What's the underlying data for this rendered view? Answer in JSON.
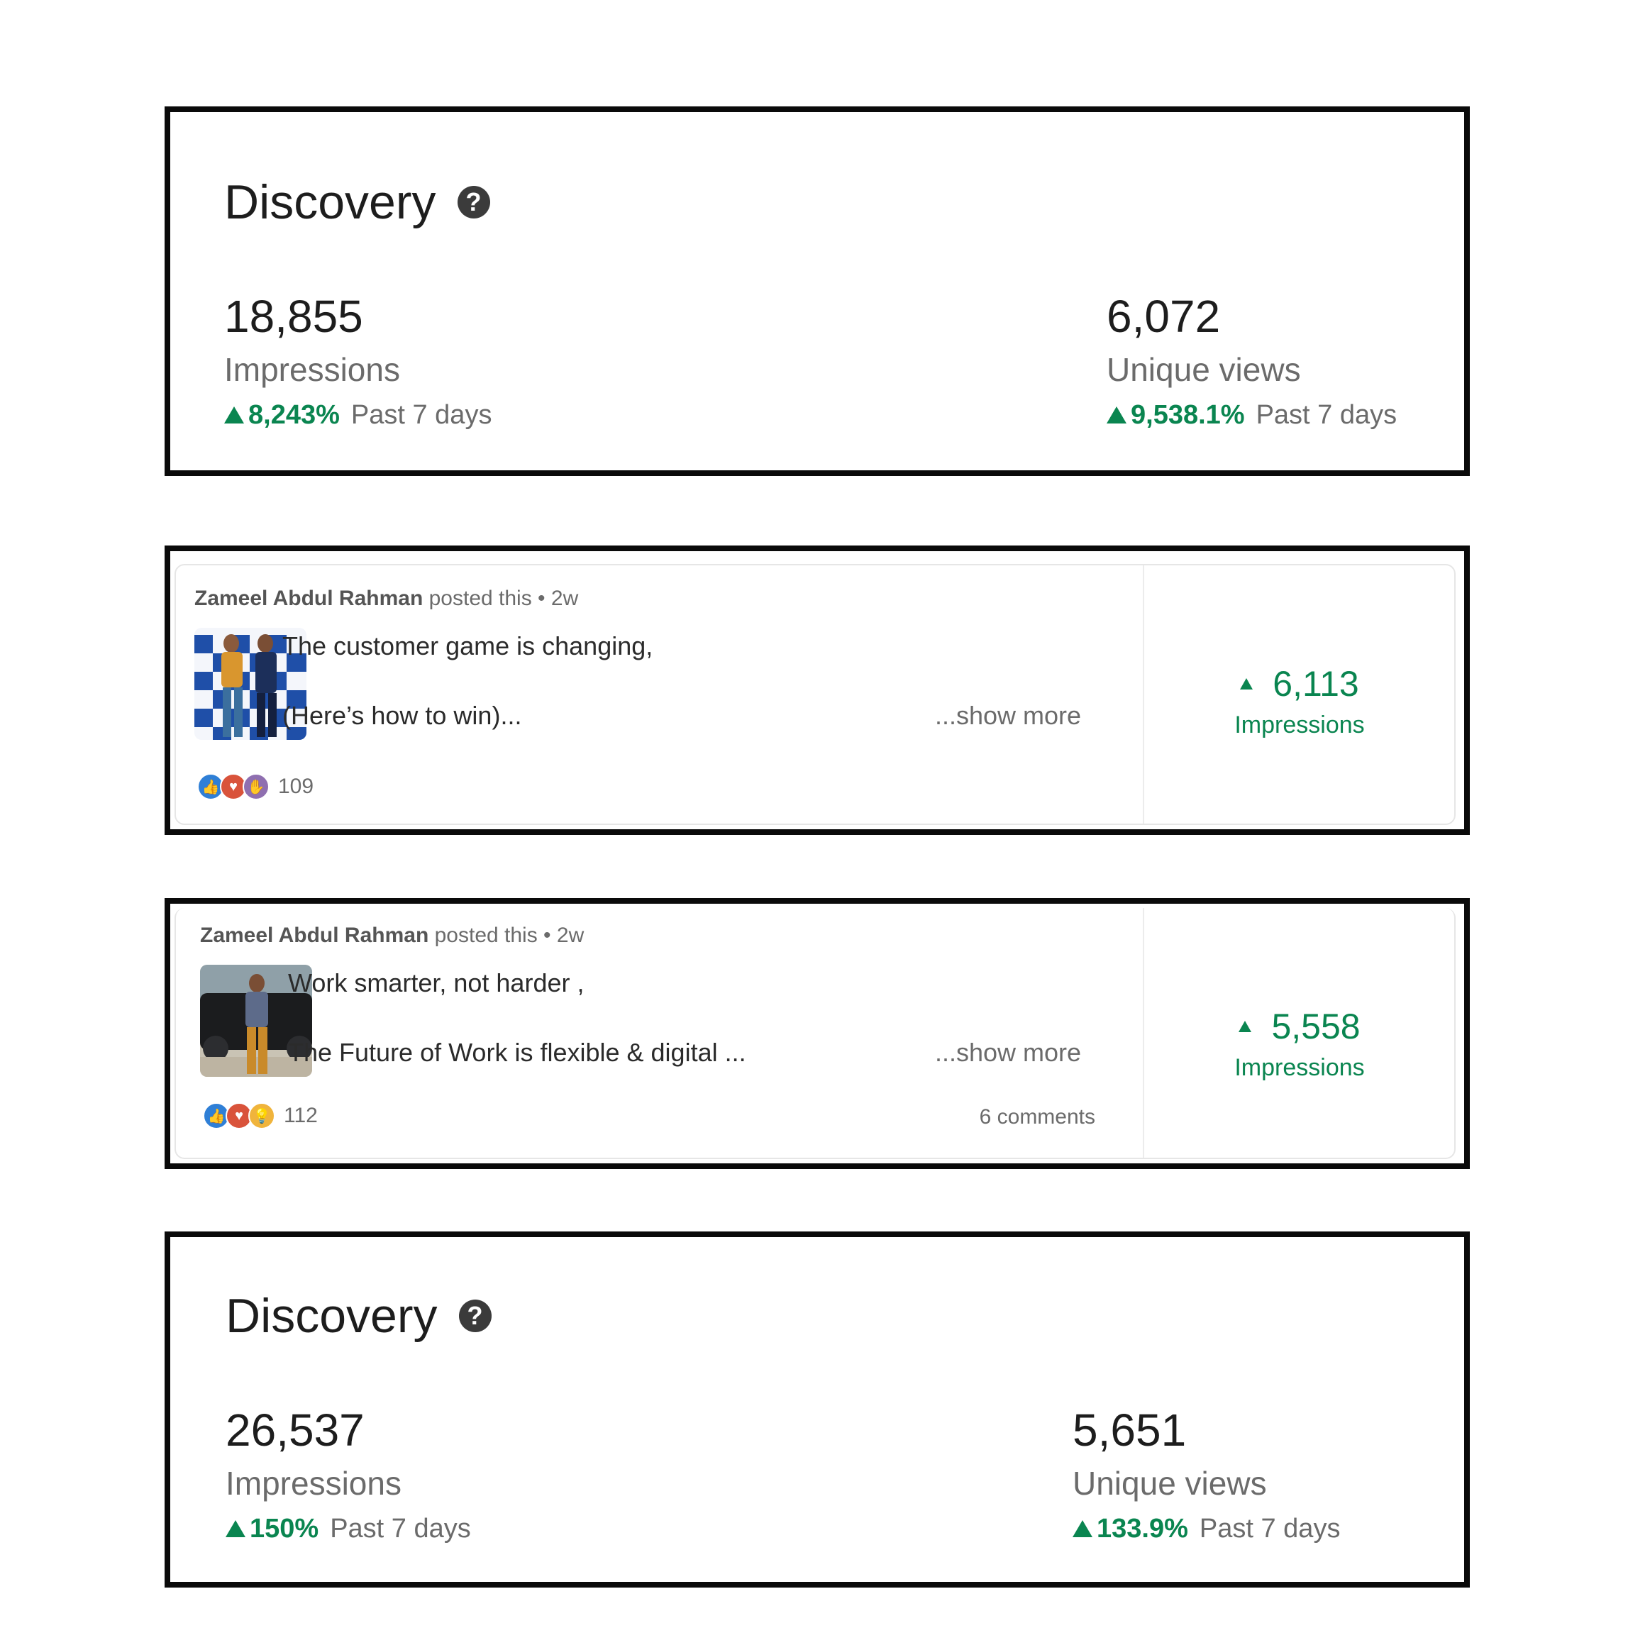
{
  "discovery_top": {
    "title": "Discovery",
    "impressions": {
      "value": "18,855",
      "label": "Impressions",
      "change": "8,243%",
      "period": "Past 7 days"
    },
    "unique_views": {
      "value": "6,072",
      "label": "Unique views",
      "change": "9,538.1%",
      "period": "Past 7 days"
    }
  },
  "posts": [
    {
      "author": "Zameel Abdul Rahman",
      "meta": "posted this • 2w",
      "line1": "The customer game is changing,",
      "line2": "(Here’s how to win)...",
      "show_more": "...show more",
      "reaction_count": "109",
      "impressions": "6,113",
      "impressions_label": "Impressions"
    },
    {
      "author": "Zameel Abdul Rahman",
      "meta": "posted this • 2w",
      "line1": "Work smarter, not harder ,",
      "line2": "The Future of Work is flexible & digital ...",
      "show_more": "...show more",
      "reaction_count": "112",
      "comments": "6 comments",
      "impressions": "5,558",
      "impressions_label": "Impressions"
    }
  ],
  "discovery_bottom": {
    "title": "Discovery",
    "impressions": {
      "value": "26,537",
      "label": "Impressions",
      "change": "150%",
      "period": "Past 7 days"
    },
    "unique_views": {
      "value": "5,651",
      "label": "Unique views",
      "change": "133.9%",
      "period": "Past 7 days"
    }
  },
  "colors": {
    "positive": "#0a8550",
    "border": "#0a0a0a",
    "muted": "#6b6b6b"
  },
  "icons": [
    "question-circle-icon",
    "triangle-up-icon",
    "like-reaction-icon",
    "love-reaction-icon",
    "support-reaction-icon",
    "insightful-reaction-icon"
  ]
}
